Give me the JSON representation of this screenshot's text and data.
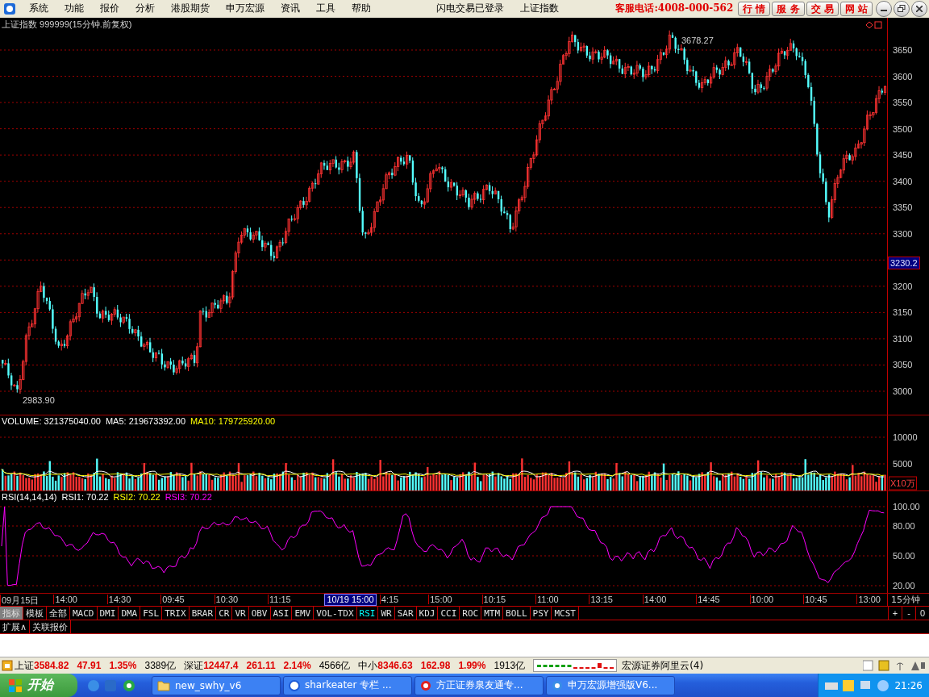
{
  "menu": {
    "items": [
      "系统",
      "功能",
      "报价",
      "分析",
      "港股期货",
      "申万宏源",
      "资讯",
      "工具",
      "帮助"
    ],
    "status": [
      "闪电交易已登录",
      "上证指数"
    ],
    "hotline": "客服电话:4008-000-562",
    "buttons": [
      "行 情",
      "服 务",
      "交 易",
      "网 站"
    ]
  },
  "chart": {
    "title": "上证指数 999999(15分钟.前复权)",
    "price_ticks": [
      "3650",
      "3600",
      "3550",
      "3500",
      "3450",
      "3400",
      "3350",
      "3300",
      "3200",
      "3150",
      "3100",
      "3050",
      "3000"
    ],
    "high_label": "3678.27",
    "low_label": "2983.90",
    "current_price": "3230.2"
  },
  "volume": {
    "legend": [
      {
        "text": "VOLUME: 321375040.00",
        "color": "#ffffff"
      },
      {
        "text": "MA5: 219673392.00",
        "color": "#ffffff"
      },
      {
        "text": "MA10: 179725920.00",
        "color": "#ffff00"
      }
    ],
    "ticks": [
      "10000",
      "5000"
    ],
    "unit": "X10万"
  },
  "rsi": {
    "legend": [
      {
        "text": "RSI(14,14,14)",
        "color": "#ffffff"
      },
      {
        "text": "RSI1: 70.22",
        "color": "#ffffff"
      },
      {
        "text": "RSI2: 70.22",
        "color": "#ffff00"
      },
      {
        "text": "RSI3: 70.22",
        "color": "#ff00ff"
      }
    ],
    "ticks": [
      "100.00",
      "80.00",
      "50.00",
      "20.00"
    ]
  },
  "time_axis": {
    "labels": [
      {
        "text": "09月15日",
        "kind": "label"
      },
      {
        "text": "14:00",
        "kind": "label"
      },
      {
        "text": "14:30",
        "kind": "label"
      },
      {
        "text": "09:45",
        "kind": "label"
      },
      {
        "text": "10:30",
        "kind": "label"
      },
      {
        "text": "11:15",
        "kind": "label"
      },
      {
        "text": "10/19 15:00",
        "kind": "cursor"
      },
      {
        "text": "4:15",
        "kind": "label"
      },
      {
        "text": "15:00",
        "kind": "label"
      },
      {
        "text": "10:15",
        "kind": "label"
      },
      {
        "text": "11:00",
        "kind": "label"
      },
      {
        "text": "13:15",
        "kind": "label"
      },
      {
        "text": "14:00",
        "kind": "label"
      },
      {
        "text": "14:45",
        "kind": "label"
      },
      {
        "text": "10:00",
        "kind": "label"
      },
      {
        "text": "10:45",
        "kind": "label"
      },
      {
        "text": "13:00",
        "kind": "label"
      }
    ],
    "period": "15分钟"
  },
  "indicator_tabs": [
    {
      "label": "指标",
      "kind": "group",
      "selected": true
    },
    {
      "label": "模板",
      "kind": "group",
      "selected": false
    },
    {
      "label": "全部",
      "kind": "group",
      "selected": false
    },
    {
      "label": "MACD",
      "kind": "indicator",
      "selected": false
    },
    {
      "label": "DMI",
      "kind": "indicator",
      "selected": false
    },
    {
      "label": "DMA",
      "kind": "indicator",
      "selected": false
    },
    {
      "label": "FSL",
      "kind": "indicator",
      "selected": false
    },
    {
      "label": "TRIX",
      "kind": "indicator",
      "selected": false
    },
    {
      "label": "BRAR",
      "kind": "indicator",
      "selected": false
    },
    {
      "label": "CR",
      "kind": "indicator",
      "selected": false
    },
    {
      "label": "VR",
      "kind": "indicator",
      "selected": false
    },
    {
      "label": "OBV",
      "kind": "indicator",
      "selected": false
    },
    {
      "label": "ASI",
      "kind": "indicator",
      "selected": false
    },
    {
      "label": "EMV",
      "kind": "indicator",
      "selected": false
    },
    {
      "label": "VOL-TDX",
      "kind": "indicator",
      "selected": false
    },
    {
      "label": "RSI",
      "kind": "indicator",
      "selected": true
    },
    {
      "label": "WR",
      "kind": "indicator",
      "selected": false
    },
    {
      "label": "SAR",
      "kind": "indicator",
      "selected": false
    },
    {
      "label": "KDJ",
      "kind": "indicator",
      "selected": false
    },
    {
      "label": "CCI",
      "kind": "indicator",
      "selected": false
    },
    {
      "label": "ROC",
      "kind": "indicator",
      "selected": false
    },
    {
      "label": "MTM",
      "kind": "indicator",
      "selected": false
    },
    {
      "label": "BOLL",
      "kind": "indicator",
      "selected": false
    },
    {
      "label": "PSY",
      "kind": "indicator",
      "selected": false
    },
    {
      "label": "MCST",
      "kind": "indicator",
      "selected": false
    }
  ],
  "zoom_buttons": [
    "+",
    "-",
    "0"
  ],
  "extra_tabs": [
    "扩展∧",
    "关联报价"
  ],
  "status_bar": {
    "indices": [
      {
        "name": "上证",
        "value": "3584.82",
        "change": "47.91",
        "percent": "1.35%",
        "amount": "3389亿"
      },
      {
        "name": "深证",
        "value": "12447.4",
        "change": "261.11",
        "percent": "2.14%",
        "amount": "4566亿"
      },
      {
        "name": "中小",
        "value": "8346.63",
        "change": "162.98",
        "percent": "1.99%",
        "amount": "1913亿"
      }
    ],
    "broker": "宏源证券阿里云(4)"
  },
  "taskbar": {
    "start": "开始",
    "tasks": [
      "new_swhy_v6",
      "sharkeater 专栏 ...",
      "方正证券泉友通专...",
      "申万宏源增强版V6..."
    ],
    "clock": "21:26"
  }
}
